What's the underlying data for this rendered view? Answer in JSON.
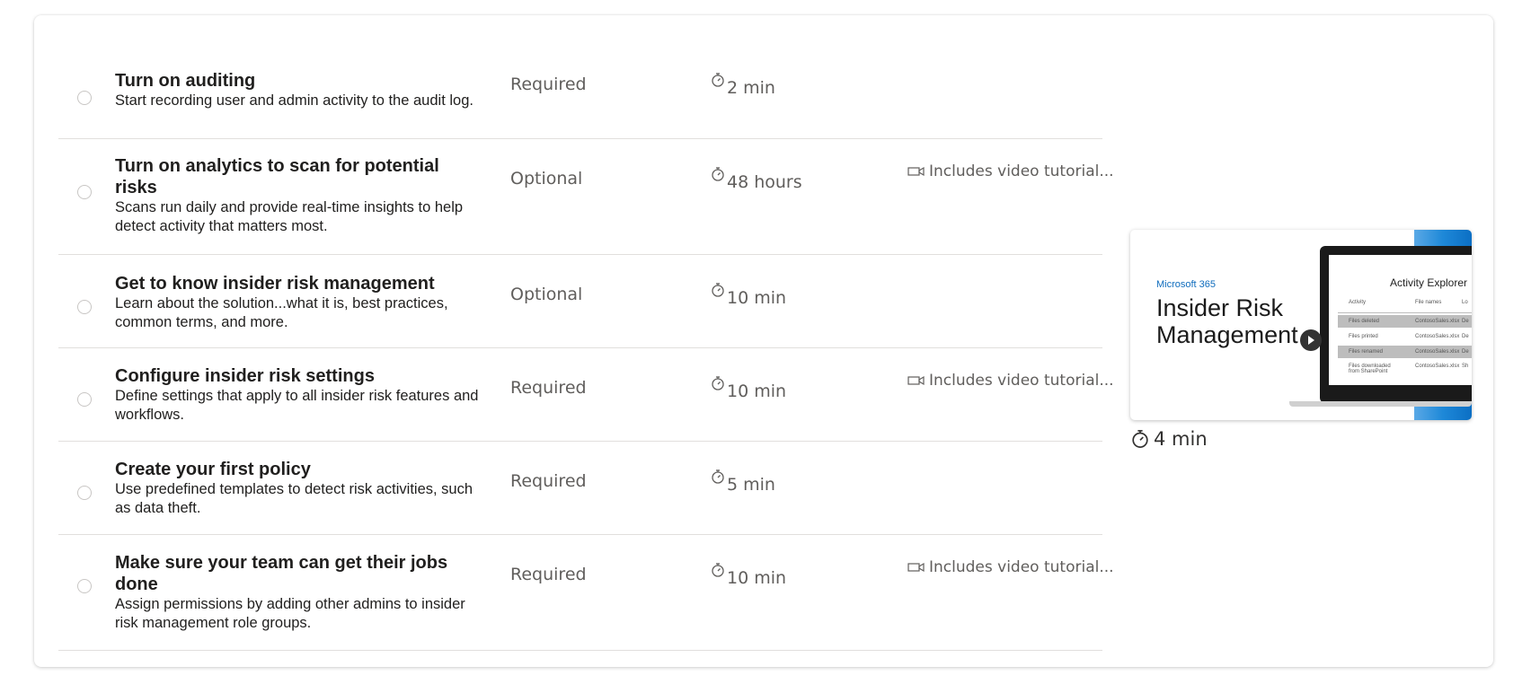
{
  "steps": [
    {
      "title": "Turn on auditing",
      "description": "Start recording user and admin activity to the audit log.",
      "requirement": "Required",
      "time": "2 min",
      "video": ""
    },
    {
      "title": "Turn on analytics to scan for potential risks",
      "description": "Scans run daily and provide real-time insights to help detect activity that matters most.",
      "requirement": "Optional",
      "time": "48 hours",
      "video": "Includes video tutorial..."
    },
    {
      "title": "Get to know insider risk management",
      "description": "Learn about the solution...what it is, best practices, common terms, and more.",
      "requirement": "Optional",
      "time": "10 min",
      "video": ""
    },
    {
      "title": "Configure insider risk settings",
      "description": "Define settings that apply to all insider risk features and workflows.",
      "requirement": "Required",
      "time": "10 min",
      "video": "Includes video tutorial..."
    },
    {
      "title": "Create your first policy",
      "description": "Use predefined templates to detect risk activities, such as data theft.",
      "requirement": "Required",
      "time": "5 min",
      "video": ""
    },
    {
      "title": "Make sure your team can get their jobs done",
      "description": "Assign permissions by adding other admins to insider risk management role groups.",
      "requirement": "Required",
      "time": "10 min",
      "video": "Includes video tutorial..."
    }
  ],
  "video_card": {
    "brand": "Microsoft 365",
    "title": "Insider Risk Management",
    "screen_title": "Activity Explorer",
    "columns": [
      "Activity",
      "File names",
      "Lo"
    ],
    "rows": [
      [
        "Files deleted",
        "ContosoSales.xlsx",
        "De"
      ],
      [
        "Files printed",
        "ContosoSales.xlsx",
        "De"
      ],
      [
        "Files renamed",
        "ContosoSales.xlsx",
        "De"
      ],
      [
        "Files downloaded from SharePoint",
        "ContosoSales.xlsx",
        "Sh"
      ]
    ],
    "duration": "4 min"
  },
  "icons": {
    "timer": "stopwatch-icon",
    "video": "video-camera-icon",
    "play": "play-icon"
  }
}
